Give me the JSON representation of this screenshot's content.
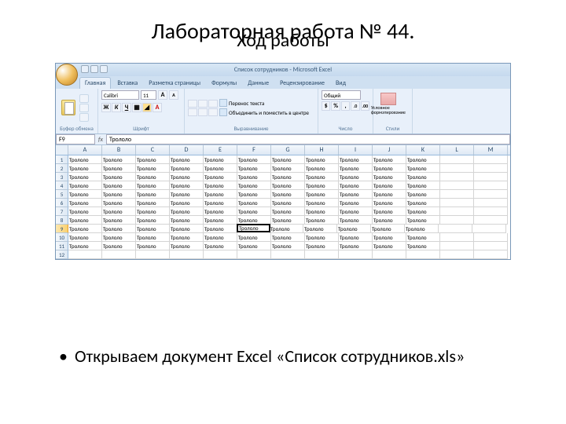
{
  "slide": {
    "title": "Лабораторная работа № 44.",
    "subtitle": "Ход работы",
    "bullet": "•",
    "bulletText": "Открываем документ Excel «Список сотрудников.xls»"
  },
  "excel": {
    "windowTitle": "Список сотрудников - Microsoft Excel",
    "tabs": [
      "Главная",
      "Вставка",
      "Разметка страницы",
      "Формулы",
      "Данные",
      "Рецензирование",
      "Вид"
    ],
    "groups": {
      "clipboard": "Буфер обмена",
      "font": "Шрифт",
      "alignment": "Выравнивание",
      "number": "Число",
      "styles": "Стили"
    },
    "font": {
      "name": "Calibri",
      "size": "11"
    },
    "fontButtons": {
      "bold": "Ж",
      "italic": "К",
      "underline": "Ч"
    },
    "wrapText": "Перенос текста",
    "mergeCenter": "Объединить и поместить в центре",
    "numberFormat": "Общий",
    "stylesLabel": "Условное форматирование",
    "nameBox": "F9",
    "formulaValue": "Трололо",
    "columns": [
      "A",
      "B",
      "C",
      "D",
      "E",
      "F",
      "G",
      "H",
      "I",
      "J",
      "K",
      "L",
      "M"
    ],
    "rows": [
      "1",
      "2",
      "3",
      "4",
      "5",
      "6",
      "7",
      "8",
      "9",
      "10",
      "11",
      "12"
    ],
    "cellValue": "Трололо",
    "activeRow": 9,
    "activeCol": "F",
    "dataCols": 11,
    "dataRows": 11
  }
}
